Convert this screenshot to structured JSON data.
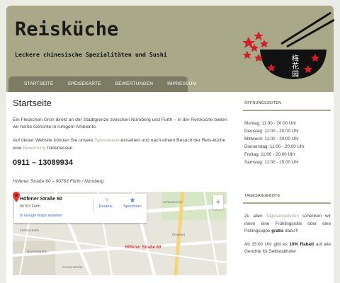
{
  "site": {
    "title": "Reisküche",
    "tagline": "Leckere chinesische Spezialitäten und Sushi",
    "bowl_text": [
      "梅",
      "花",
      "园"
    ]
  },
  "nav": {
    "items": [
      "Startseite",
      "Speisekarte",
      "Bewertungen",
      "Impressum"
    ]
  },
  "main": {
    "heading": "Startseite",
    "intro": "Ein Fleckchen Grün direkt an der Stadtgrenze zwischen Nürnberg und Fürth – in der Reisküche bieten wir heiße Gerichte in ruhigem Ambiente.",
    "visit_before": "Auf dieser Website können Sie unsere ",
    "visit_link1": "Speisekarte",
    "visit_middle": " einsehen und nach einem Besuch der Reis-küche eine ",
    "visit_link2": "Bewertung",
    "visit_after": " hinterlassen.",
    "phone": "0911 – 13089934",
    "address": "Höfener Straße 60 – 90763 Fürth / Nürnberg"
  },
  "map": {
    "place_name": "Höfener Straße 60",
    "place_city": "90763 Fürth",
    "open_link": "In Google Maps ansehen",
    "route_label": "Routen...",
    "save_label": "Speichern",
    "pin_label": "Höfener Straße 60",
    "zoom_label": "+",
    "street_labels": [
      "Schwabacher",
      "Flößaustraße",
      "Heckenstraße",
      "Ringweg",
      "Sonnenstraße"
    ]
  },
  "sidebar": {
    "hours_title": "Öffnungszeiten",
    "hours": [
      "Montag: 11:00 - 20:00 Uhr",
      "Dienstag: 11:00 - 20:00 Uhr",
      "Mittwoch: 11:00 - 20:00 Uhr",
      "Donnerstag: 11:00 - 20:00 Uhr",
      "Freitag: 11:00 - 20:00 Uhr",
      "Samstag: 11:00 - 15:00 Uhr"
    ],
    "specials_title": "Tagesangebote",
    "special1_before": "Zu allen ",
    "special1_link": "Tagesangeboten",
    "special1_middle": " schenken wir ihnen eine Frühlingsrolle oder eine Pekingsuppe ",
    "special1_bold": "gratis",
    "special1_after": " dazu!!!",
    "special2_before": "Ab 15:00 Uhr gibt es ",
    "special2_bold": "10% Rabatt",
    "special2_after": " auf alle Gerichte für Selbstabholer"
  },
  "colors": {
    "header_bg": "#a9a98a",
    "nav_bg": "#7c7b64",
    "accent_red": "#d0202c",
    "link": "#a8a890"
  }
}
